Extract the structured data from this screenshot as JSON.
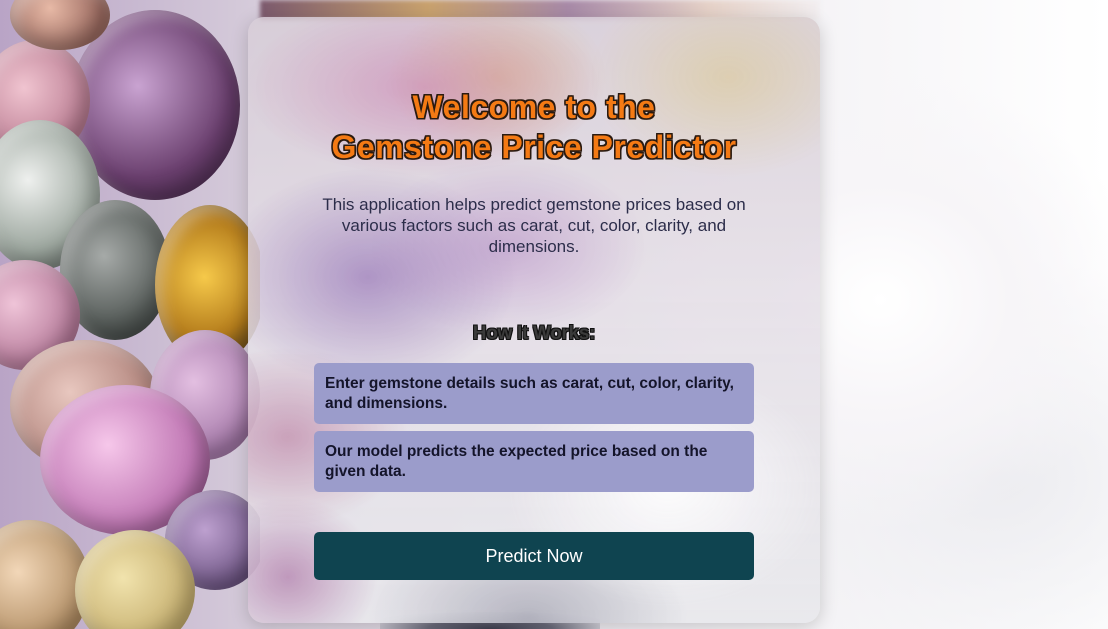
{
  "title": {
    "line1": "Welcome to the",
    "line2": "Gemstone Price Predictor"
  },
  "description": "This application helps predict gemstone prices based on various factors such as carat, cut, color, clarity, and dimensions.",
  "how_it_works": {
    "heading": "How It Works:",
    "steps": [
      "Enter gemstone details such as carat, cut, color, clarity, and dimensions.",
      "Our model predicts the expected price based on the given data."
    ]
  },
  "predict_button": {
    "label": "Predict Now"
  },
  "colors": {
    "title_orange": "#f47a14",
    "step_box": "#9b9ccb",
    "button_bg": "#0f4450"
  }
}
